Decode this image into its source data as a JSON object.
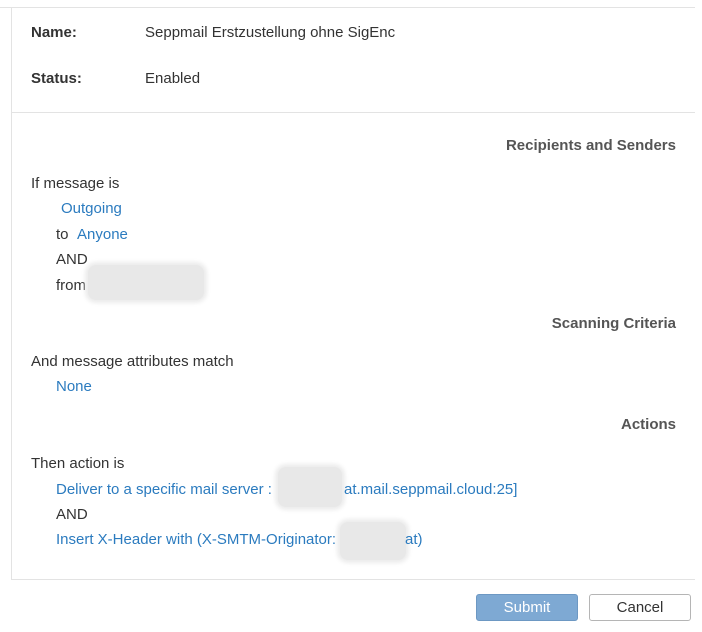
{
  "summary": {
    "name_label": "Name:",
    "name_value": "Seppmail Erstzustellung ohne SigEnc",
    "status_label": "Status:",
    "status_value": "Enabled"
  },
  "recipients_section": {
    "header": "Recipients and Senders",
    "intro": "If message is",
    "direction": "Outgoing",
    "to_label": "to",
    "to_value": "Anyone",
    "and_label": "AND",
    "from_label": "from"
  },
  "scanning_section": {
    "header": "Scanning Criteria",
    "intro": "And message attributes match",
    "value": "None"
  },
  "actions_section": {
    "header": "Actions",
    "intro": "Then action is",
    "action1_prefix": "Deliver to a specific mail server :",
    "action1_suffix": "at.mail.seppmail.cloud:25]",
    "and_label": "AND",
    "action2_prefix": "Insert X-Header with (X-SMTM-Originator:",
    "action2_suffix": "at)"
  },
  "footer": {
    "submit_label": "Submit",
    "cancel_label": "Cancel"
  },
  "colors": {
    "link": "#2b7bbf",
    "submit_bg": "#7ea9d3",
    "border": "#e3e3e3"
  }
}
